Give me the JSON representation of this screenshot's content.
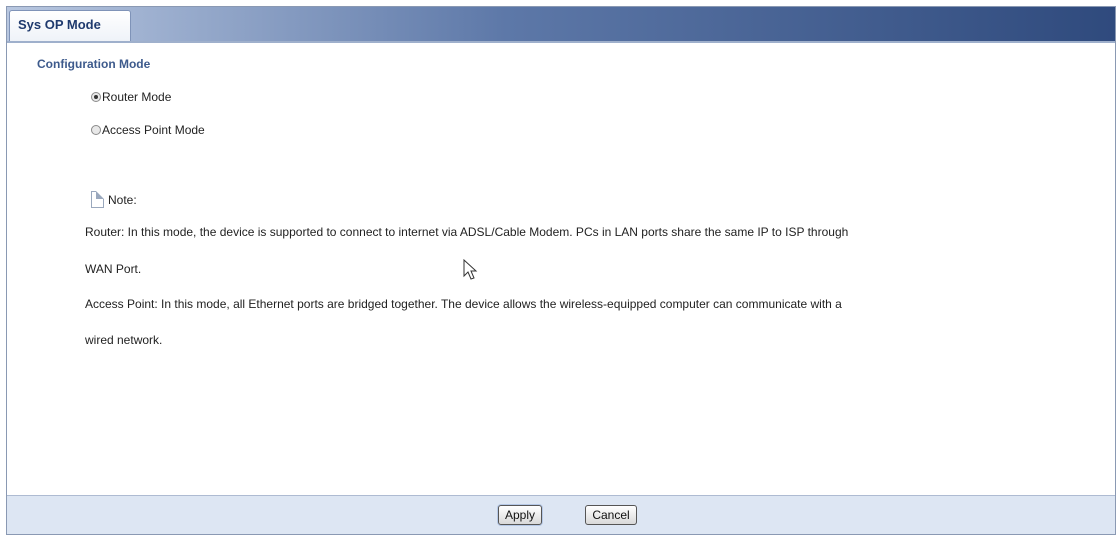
{
  "tabs": [
    {
      "label": "Sys OP Mode"
    }
  ],
  "section": {
    "title": "Configuration Mode"
  },
  "modes": [
    {
      "label": "Router Mode",
      "checked": true
    },
    {
      "label": "Access Point Mode",
      "checked": false
    }
  ],
  "note": {
    "label": "Note:",
    "lines": [
      "Router: In this mode, the device is supported to connect to internet via ADSL/Cable Modem. PCs in LAN ports share the same IP to ISP through",
      "WAN Port.",
      "Access Point: In this mode, all Ethernet ports are bridged together. The device allows the wireless-equipped computer can communicate with a",
      "wired network."
    ]
  },
  "footer": {
    "apply_label": "Apply",
    "cancel_label": "Cancel"
  },
  "icons": {
    "note": "note-page-icon",
    "cursor": "mouse-pointer-icon"
  }
}
